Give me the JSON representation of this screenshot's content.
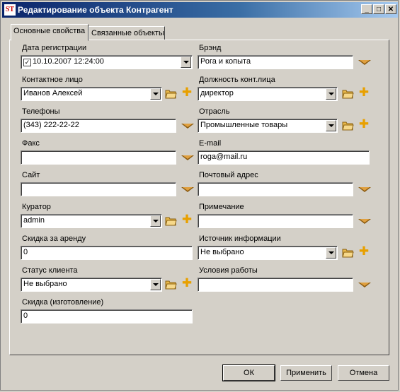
{
  "window": {
    "title": "Редактирование объекта Контрагент",
    "logo": "ST"
  },
  "tabs": [
    {
      "label": "Основные свойства",
      "active": true
    },
    {
      "label": "Связанные объекты",
      "active": false
    }
  ],
  "form": {
    "reg_date": {
      "label": "Дата регистрации",
      "value": "10.10.2007 12:24:00",
      "checked": true
    },
    "brand": {
      "label": "Брэнд",
      "value": "Рога и копыта"
    },
    "contact": {
      "label": "Контактное лицо",
      "value": "Иванов Алексей"
    },
    "contact_position": {
      "label": "Должность конт.лица",
      "value": "директор"
    },
    "phones": {
      "label": "Телефоны",
      "value": "(343) 222-22-22"
    },
    "industry": {
      "label": "Отрасль",
      "value": "Промышленные товары"
    },
    "fax": {
      "label": "Факс",
      "value": ""
    },
    "email": {
      "label": "E-mail",
      "value": "roga@mail.ru"
    },
    "site": {
      "label": "Сайт",
      "value": ""
    },
    "postal": {
      "label": "Почтовый адрес",
      "value": ""
    },
    "curator": {
      "label": "Куратор",
      "value": "admin"
    },
    "note": {
      "label": "Примечание",
      "value": ""
    },
    "rent_discount": {
      "label": "Скидка за аренду",
      "value": "0"
    },
    "info_source": {
      "label": "Источник информации",
      "value": "Не выбрано"
    },
    "client_status": {
      "label": "Статус клиента",
      "value": "Не выбрано"
    },
    "work_conditions": {
      "label": "Условия работы",
      "value": ""
    },
    "mfg_discount": {
      "label": "Скидка (изготовление)",
      "value": "0"
    }
  },
  "buttons": {
    "ok": "ОК",
    "apply": "Применить",
    "cancel": "Отмена"
  },
  "icons": {
    "dropdown": "dropdown-arrow-icon",
    "folder": "open-folder-icon",
    "plus": "add-plus-icon",
    "minimize": "_",
    "maximize": "□",
    "close": "✕"
  }
}
